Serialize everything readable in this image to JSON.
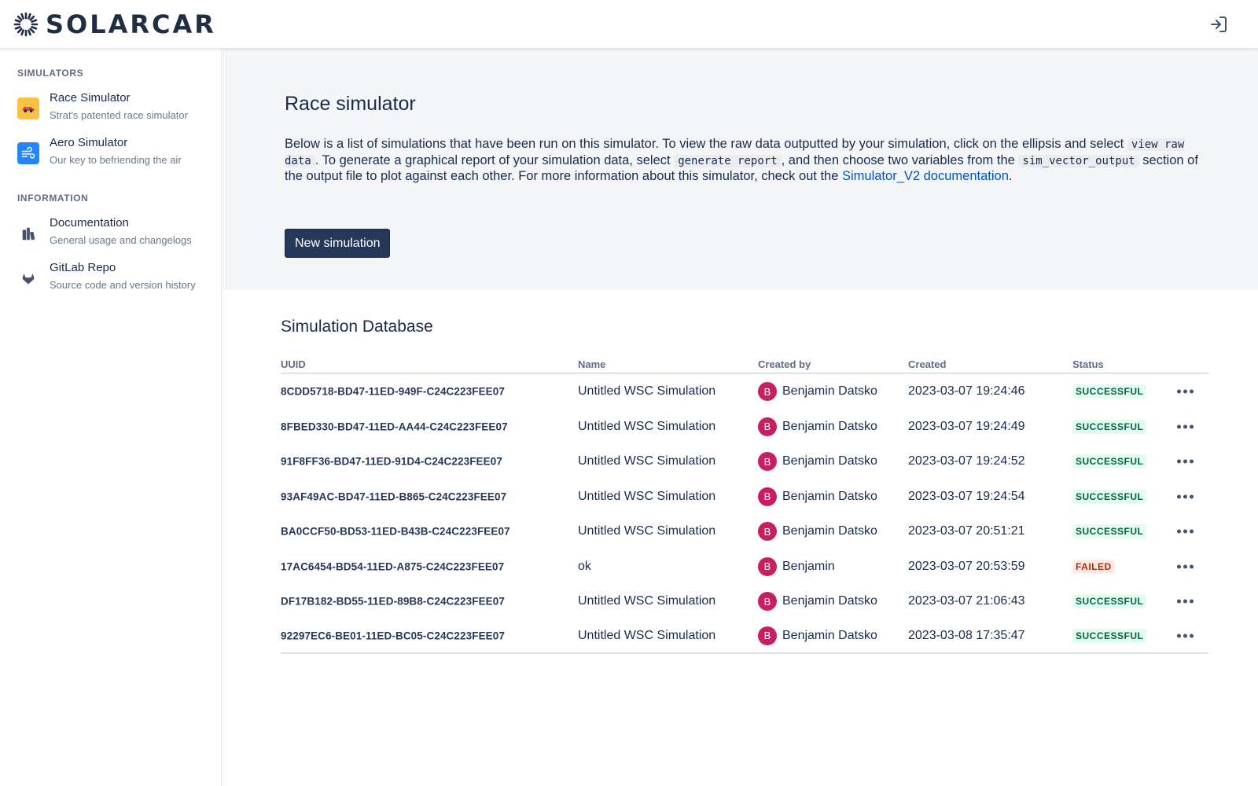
{
  "app": {
    "brand": "SOLARCAR"
  },
  "sidebar": {
    "sections": [
      {
        "label": "SIMULATORS"
      },
      {
        "label": "INFORMATION"
      }
    ],
    "items": [
      {
        "title": "Race Simulator",
        "subtitle": "Strat's patented race simulator",
        "icon": "race-car-icon",
        "color": "#f6c342"
      },
      {
        "title": "Aero Simulator",
        "subtitle": "Our key to befriending the air",
        "icon": "wind-icon",
        "color": "#2684ff"
      },
      {
        "title": "Documentation",
        "subtitle": "General usage and changelogs",
        "icon": "books-icon",
        "color": "#42526e"
      },
      {
        "title": "GitLab Repo",
        "subtitle": "Source code and version history",
        "icon": "gitlab-icon",
        "color": "#42526e"
      }
    ]
  },
  "hero": {
    "title": "Race simulator",
    "desc_1": "Below is a list of simulations that have been run on this simulator. To view the raw data outputted by your simulation, click on the ellipsis and select",
    "code_1": "view raw data",
    "desc_2": ". To generate a graphical report of your simulation data, select",
    "code_2": "generate report",
    "desc_3": ", and then choose two variables from the",
    "code_3": "sim_vector_output",
    "desc_4": "section of the output file to plot against each other. For more information about this simulator, check out the",
    "link": "Simulator_V2 documentation",
    "desc_5": ".",
    "button": "New simulation"
  },
  "database": {
    "title": "Simulation Database",
    "columns": [
      "UUID",
      "Name",
      "Created by",
      "Created",
      "Status"
    ],
    "rows": [
      {
        "uuid": "8CDD5718-BD47-11ED-949F-C24C223FEE07",
        "name": "Untitled WSC Simulation",
        "initial": "B",
        "creator": "Benjamin Datsko",
        "created": "2023-03-07 19:24:46",
        "status": "SUCCESSFUL"
      },
      {
        "uuid": "8FBED330-BD47-11ED-AA44-C24C223FEE07",
        "name": "Untitled WSC Simulation",
        "initial": "B",
        "creator": "Benjamin Datsko",
        "created": "2023-03-07 19:24:49",
        "status": "SUCCESSFUL"
      },
      {
        "uuid": "91F8FF36-BD47-11ED-91D4-C24C223FEE07",
        "name": "Untitled WSC Simulation",
        "initial": "B",
        "creator": "Benjamin Datsko",
        "created": "2023-03-07 19:24:52",
        "status": "SUCCESSFUL"
      },
      {
        "uuid": "93AF49AC-BD47-11ED-B865-C24C223FEE07",
        "name": "Untitled WSC Simulation",
        "initial": "B",
        "creator": "Benjamin Datsko",
        "created": "2023-03-07 19:24:54",
        "status": "SUCCESSFUL"
      },
      {
        "uuid": "BA0CCF50-BD53-11ED-B43B-C24C223FEE07",
        "name": "Untitled WSC Simulation",
        "initial": "B",
        "creator": "Benjamin Datsko",
        "created": "2023-03-07 20:51:21",
        "status": "SUCCESSFUL"
      },
      {
        "uuid": "17AC6454-BD54-11ED-A875-C24C223FEE07",
        "name": "ok",
        "initial": "B",
        "creator": "Benjamin",
        "created": "2023-03-07 20:53:59",
        "status": "FAILED"
      },
      {
        "uuid": "DF17B182-BD55-11ED-89B8-C24C223FEE07",
        "name": "Untitled WSC Simulation",
        "initial": "B",
        "creator": "Benjamin Datsko",
        "created": "2023-03-07 21:06:43",
        "status": "SUCCESSFUL"
      },
      {
        "uuid": "92297EC6-BE01-11ED-BC05-C24C223FEE07",
        "name": "Untitled WSC Simulation",
        "initial": "B",
        "creator": "Benjamin Datsko",
        "created": "2023-03-08 17:35:47",
        "status": "SUCCESSFUL"
      }
    ]
  },
  "colors": {
    "avatar": "#c71f62",
    "success": "#006644",
    "failed": "#bf2600",
    "primary": "#253858"
  }
}
